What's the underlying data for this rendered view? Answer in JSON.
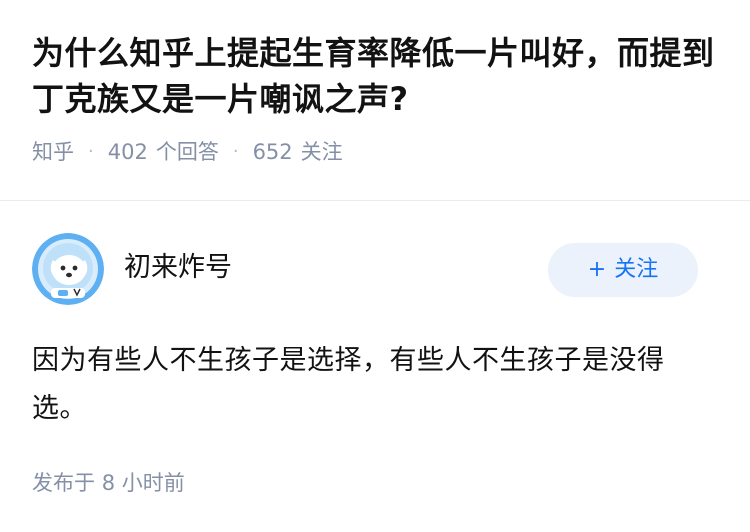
{
  "question": {
    "title": "为什么知乎上提起生育率降低一片叫好，而提到丁克族又是一片嘲讽之声?",
    "source": "知乎",
    "answer_count": "402",
    "answer_label": "个回答",
    "follower_count": "652",
    "follower_label": "关注"
  },
  "answer": {
    "author": {
      "name": "初来炸号",
      "avatar_icon": "astronaut-dog-avatar"
    },
    "follow_button": {
      "plus": "+",
      "label": "关注"
    },
    "content": "因为有些人不生孩子是选择，有些人不生孩子是没得选。",
    "published_label": "发布于",
    "published_time": "8 小时前"
  },
  "colors": {
    "title": "#121212",
    "meta": "#8590a6",
    "accent": "#1772f6",
    "button_bg": "#ebf2fb",
    "avatar_bg": "#5eb0f3"
  }
}
